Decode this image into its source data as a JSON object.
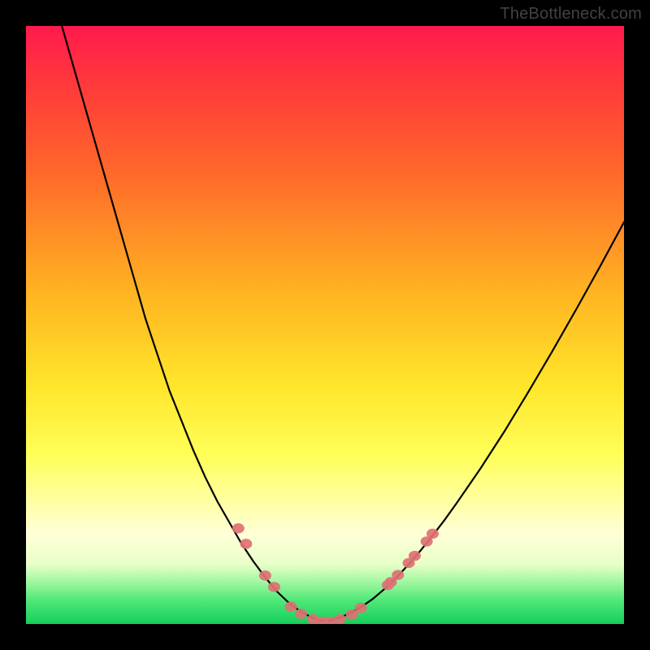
{
  "watermark": "TheBottleneck.com",
  "chart_data": {
    "type": "line",
    "title": "",
    "xlabel": "",
    "ylabel": "",
    "xlim": [
      0,
      100
    ],
    "ylim": [
      0,
      100
    ],
    "grid": false,
    "legend": false,
    "series": [
      {
        "name": "left-curve",
        "color": "#000000",
        "points": [
          [
            6,
            100
          ],
          [
            8,
            93
          ],
          [
            10,
            86
          ],
          [
            12,
            79
          ],
          [
            14,
            72
          ],
          [
            16,
            65
          ],
          [
            18,
            58
          ],
          [
            20,
            51
          ],
          [
            22,
            45
          ],
          [
            24,
            39
          ],
          [
            26,
            34
          ],
          [
            28,
            29
          ],
          [
            30,
            24.5
          ],
          [
            32,
            20.5
          ],
          [
            34,
            17
          ],
          [
            36,
            13.5
          ],
          [
            38,
            10.5
          ],
          [
            40,
            7.8
          ],
          [
            42,
            5.4
          ],
          [
            44,
            3.5
          ],
          [
            46,
            2.0
          ],
          [
            48,
            1.0
          ],
          [
            49,
            0.6
          ],
          [
            50,
            0.5
          ]
        ]
      },
      {
        "name": "right-curve",
        "color": "#000000",
        "points": [
          [
            50,
            0.5
          ],
          [
            51,
            0.6
          ],
          [
            52,
            0.9
          ],
          [
            54,
            1.7
          ],
          [
            56,
            2.8
          ],
          [
            58,
            4.2
          ],
          [
            60,
            5.9
          ],
          [
            62,
            7.8
          ],
          [
            64,
            10.0
          ],
          [
            66,
            12.3
          ],
          [
            68,
            14.8
          ],
          [
            70,
            17.4
          ],
          [
            72,
            20.2
          ],
          [
            76,
            26.0
          ],
          [
            80,
            32.2
          ],
          [
            84,
            38.8
          ],
          [
            88,
            45.6
          ],
          [
            92,
            52.6
          ],
          [
            96,
            59.8
          ],
          [
            100,
            67.2
          ]
        ]
      }
    ],
    "markers": {
      "name": "bottleneck-markers",
      "color": "#e07074",
      "points": [
        [
          35.5,
          16.0
        ],
        [
          36.8,
          13.4
        ],
        [
          40.0,
          8.1
        ],
        [
          41.5,
          6.2
        ],
        [
          44.3,
          2.9
        ],
        [
          46.0,
          1.7
        ],
        [
          48.0,
          0.8
        ],
        [
          49.5,
          0.4
        ],
        [
          50.8,
          0.4
        ],
        [
          52.5,
          0.8
        ],
        [
          54.5,
          1.6
        ],
        [
          56.0,
          2.7
        ],
        [
          60.5,
          6.5
        ],
        [
          61.0,
          7.0
        ],
        [
          62.2,
          8.2
        ],
        [
          64.0,
          10.2
        ],
        [
          65.0,
          11.4
        ],
        [
          67.0,
          13.8
        ],
        [
          68.0,
          15.1
        ]
      ]
    },
    "floor_band": {
      "name": "green-floor-band",
      "ymin": 0,
      "ymax": 2.5
    }
  }
}
